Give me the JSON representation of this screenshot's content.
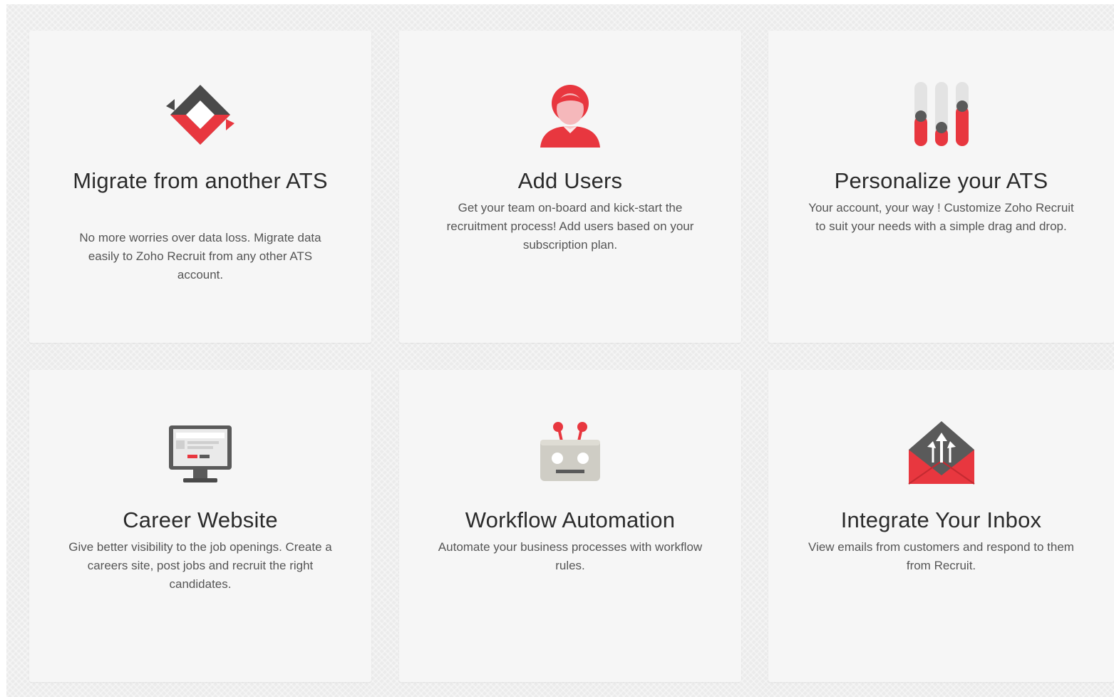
{
  "cards": [
    {
      "icon": "migrate-sync-icon",
      "title": "Migrate from another ATS",
      "description": "No more worries over data loss. Migrate data easily to Zoho Recruit from any other ATS account."
    },
    {
      "icon": "add-user-icon",
      "title": "Add Users",
      "description": "Get your team on-board and kick-start the recruitment process! Add users based on your subscription plan."
    },
    {
      "icon": "sliders-icon",
      "title": "Personalize your ATS",
      "description": "Your account, your way ! Customize Zoho Recruit to suit your needs with a simple drag and drop."
    },
    {
      "icon": "monitor-icon",
      "title": "Career Website",
      "description": "Give better visibility to the job openings. Create a careers site, post jobs and recruit the right candidates."
    },
    {
      "icon": "robot-icon",
      "title": "Workflow Automation",
      "description": "Automate your business processes with workflow rules."
    },
    {
      "icon": "envelope-icon",
      "title": "Integrate Your Inbox",
      "description": "View emails from customers and respond to them from Recruit."
    }
  ],
  "colors": {
    "accent_red": "#e8373f",
    "dark_gray": "#4a4a4a",
    "card_bg": "#f6f6f6",
    "page_bg": "#ebebeb"
  }
}
